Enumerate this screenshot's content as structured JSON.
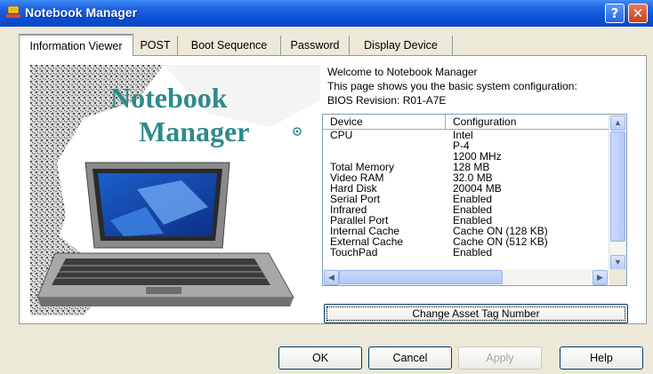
{
  "window": {
    "title": "Notebook Manager",
    "help_glyph": "?",
    "close_glyph": "✕"
  },
  "tabs": [
    {
      "label": "Information Viewer"
    },
    {
      "label": "POST"
    },
    {
      "label": "Boot Sequence"
    },
    {
      "label": "Password"
    },
    {
      "label": "Display Device"
    }
  ],
  "art": {
    "line1": "Notebook",
    "line2": "Manager",
    "logo_text": "Notebook Manager"
  },
  "welcome": {
    "line1": "Welcome to Notebook Manager",
    "line2": "This page shows you the basic system configuration:",
    "line3": "BIOS Revision: R01-A7E"
  },
  "table": {
    "headers": [
      "Device",
      "Configuration"
    ],
    "rows": [
      [
        "CPU",
        "Intel"
      ],
      [
        "",
        "P-4"
      ],
      [
        "",
        "1200 MHz"
      ],
      [
        "Total Memory",
        "128 MB"
      ],
      [
        "Video RAM",
        "32.0 MB"
      ],
      [
        "Hard Disk",
        "20004 MB"
      ],
      [
        "Serial Port",
        "Enabled"
      ],
      [
        "Infrared",
        "Enabled"
      ],
      [
        "Parallel Port",
        "Enabled"
      ],
      [
        "Internal Cache",
        "Cache ON (128 KB)"
      ],
      [
        "External Cache",
        "Cache ON (512 KB)"
      ],
      [
        "TouchPad",
        "Enabled"
      ]
    ]
  },
  "asset_button": "Change Asset Tag Number",
  "footer": {
    "ok": "OK",
    "cancel": "Cancel",
    "apply": "Apply",
    "help": "Help"
  },
  "colors": {
    "titlebar": "#0A4FD6",
    "dialog_bg": "#ECE9D8",
    "panel_bg": "#FFFFFF",
    "art_text": "#2E8B8B"
  }
}
